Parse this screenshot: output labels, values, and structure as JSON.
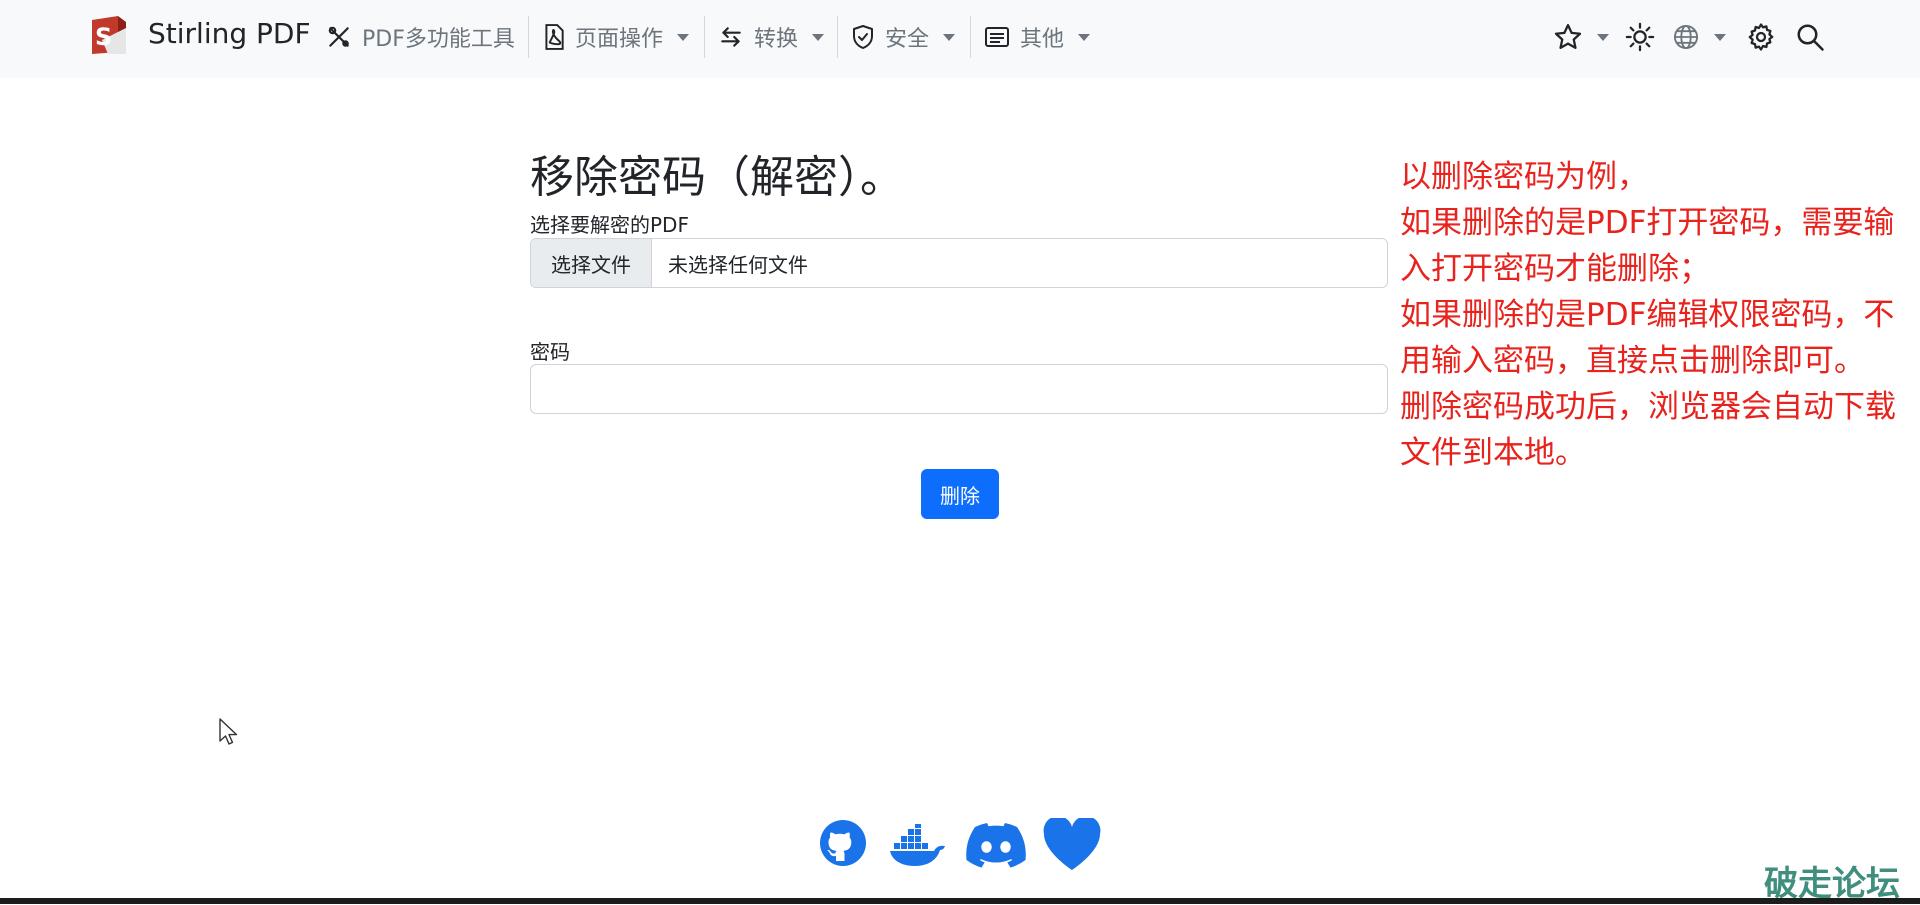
{
  "navbar": {
    "brand": "Stirling PDF",
    "items": [
      {
        "label": "PDF多功能工具",
        "icon": "tools-icon",
        "dropdown": false
      },
      {
        "label": "页面操作",
        "icon": "file-pdf-icon",
        "dropdown": true
      },
      {
        "label": "转换",
        "icon": "arrows-swap-icon",
        "dropdown": true
      },
      {
        "label": "安全",
        "icon": "shield-icon",
        "dropdown": true
      },
      {
        "label": "其他",
        "icon": "list-card-icon",
        "dropdown": true
      }
    ],
    "right_icons": [
      "star-icon",
      "sun-icon",
      "globe-icon",
      "gear-icon",
      "search-icon"
    ]
  },
  "form": {
    "title": "移除密码（解密）。",
    "file_label": "选择要解密的PDF",
    "file_button": "选择文件",
    "file_status": "未选择任何文件",
    "password_label": "密码",
    "password_value": "",
    "submit_label": "删除"
  },
  "annotation": {
    "text": "以删除密码为例，\n如果删除的是PDF打开密码，需要输入打开密码才能删除；\n如果删除的是PDF编辑权限密码，不用输入密码，直接点击删除即可。\n删除密码成功后，浏览器会自动下载文件到本地。"
  },
  "footer": {
    "icons": [
      "github-icon",
      "docker-icon",
      "discord-icon",
      "heart-icon"
    ]
  },
  "watermark": "破走论坛",
  "colors": {
    "accent": "#0d6efd",
    "annotation": "#e8221c",
    "navbar_bg": "#f8f9fa",
    "watermark": "#3f8e7e"
  }
}
